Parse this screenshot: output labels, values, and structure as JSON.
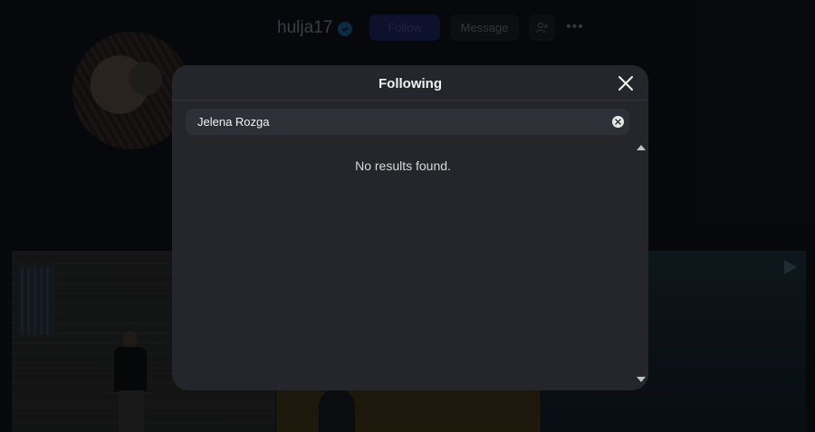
{
  "profile": {
    "username": "hulja17",
    "follow_label": "Follow",
    "message_label": "Message",
    "more_label": "•••"
  },
  "modal": {
    "title": "Following",
    "search": {
      "value": "Jelena Rozga"
    },
    "empty_message": "No results found."
  },
  "colors": {
    "modal_background": "#24262b",
    "search_background": "#2d3036",
    "page_background": "#0d1016",
    "follow_button": "#1a2050"
  }
}
